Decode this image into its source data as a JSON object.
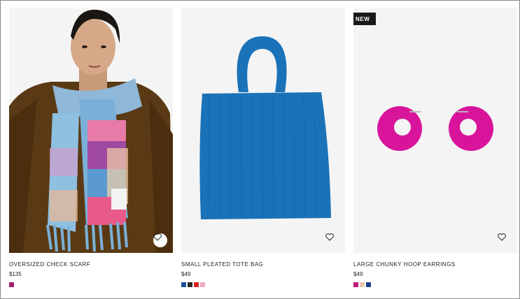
{
  "products": [
    {
      "name": "OVERSIZED CHECK SCARF",
      "price": "$135",
      "badge": "",
      "wishlist_icon": "heart-icon",
      "swatches": [
        "#a0236e"
      ]
    },
    {
      "name": "SMALL PLEATED TOTE BAG",
      "price": "$49",
      "badge": "",
      "wishlist_icon": "heart-icon",
      "swatches": [
        "#1c4f9c",
        "#2a2a2a",
        "#e02020",
        "#f4a8c8"
      ]
    },
    {
      "name": "LARGE CHUNKY HOOP EARRINGS",
      "price": "$49",
      "badge": "NEW",
      "wishlist_icon": "heart-icon",
      "swatches": [
        "#c2197a",
        "#e8c8a8",
        "#1c3f8a"
      ]
    }
  ],
  "colors": {
    "tote_blue": "#1a72b8",
    "earring_magenta": "#d8149b",
    "scarf_coat": "#5a3a14"
  }
}
